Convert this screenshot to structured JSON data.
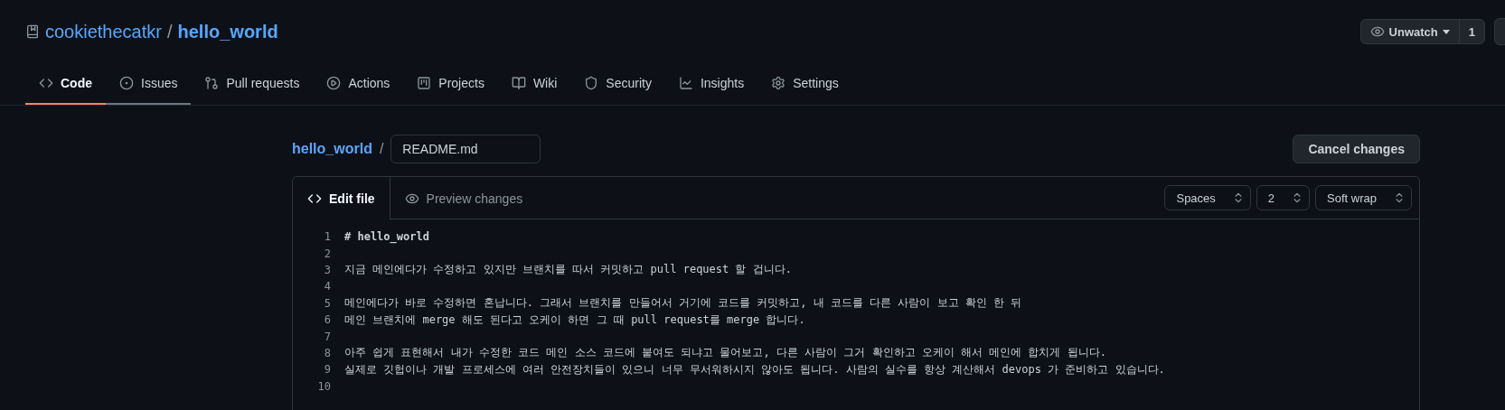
{
  "repo": {
    "owner": "cookiethecatkr",
    "separator": "/",
    "name": "hello_world"
  },
  "watch": {
    "label": "Unwatch",
    "count": "1"
  },
  "tabs": [
    {
      "label": "Code",
      "kind": "code",
      "selected": true,
      "hovered": false
    },
    {
      "label": "Issues",
      "kind": "issues",
      "selected": false,
      "hovered": true
    },
    {
      "label": "Pull requests",
      "kind": "pull",
      "selected": false,
      "hovered": false
    },
    {
      "label": "Actions",
      "kind": "actions",
      "selected": false,
      "hovered": false
    },
    {
      "label": "Projects",
      "kind": "projects",
      "selected": false,
      "hovered": false
    },
    {
      "label": "Wiki",
      "kind": "wiki",
      "selected": false,
      "hovered": false
    },
    {
      "label": "Security",
      "kind": "security",
      "selected": false,
      "hovered": false
    },
    {
      "label": "Insights",
      "kind": "insights",
      "selected": false,
      "hovered": false
    },
    {
      "label": "Settings",
      "kind": "settings",
      "selected": false,
      "hovered": false
    }
  ],
  "breadcrumb": {
    "repo": "hello_world",
    "separator": "/",
    "filename": "README.md"
  },
  "cancel_button": "Cancel changes",
  "editor_tabs": [
    {
      "label": "Edit file",
      "selected": true
    },
    {
      "label": "Preview changes",
      "selected": false
    }
  ],
  "selects": [
    {
      "value": "Spaces"
    },
    {
      "value": "2"
    },
    {
      "value": "Soft wrap"
    }
  ],
  "lines": [
    {
      "number": "1",
      "kind": "heading",
      "text": "# hello_world"
    },
    {
      "number": "2",
      "kind": "blank"
    },
    {
      "number": "3",
      "kind": "plain",
      "text": "지금 메인에다가 수정하고 있지만 브랜치를 따서 커밋하고 pull request 할 겁니다."
    },
    {
      "number": "4",
      "kind": "blank"
    },
    {
      "number": "5",
      "kind": "plain",
      "text": "메인에다가 바로 수정하면 혼납니다. 그래서 브랜치를 만들어서 거기에 코드를 커밋하고, 내 코드를 다른 사람이 보고 확인 한 뒤"
    },
    {
      "number": "6",
      "kind": "plain",
      "text": "메인 브랜치에 merge 해도 된다고 오케이 하면 그 때 pull request를 merge 합니다."
    },
    {
      "number": "7",
      "kind": "blank"
    },
    {
      "number": "8",
      "kind": "plain",
      "text": "아주 쉽게 표현해서 내가 수정한 코드 메인 소스 코드에 붙여도 되냐고 물어보고, 다른 사람이 그거 확인하고 오케이 해서 메인에 합치게 됩니다."
    },
    {
      "number": "9",
      "kind": "plain",
      "text": "실제로 깃헙이나 개발 프로세스에 여러 안전장치들이 있으니 너무 무서워하시지 않아도 됩니다. 사람의 실수를 항상 계산해서 devops 가 준비하고 있습니다."
    },
    {
      "number": "10",
      "kind": "blank"
    }
  ]
}
